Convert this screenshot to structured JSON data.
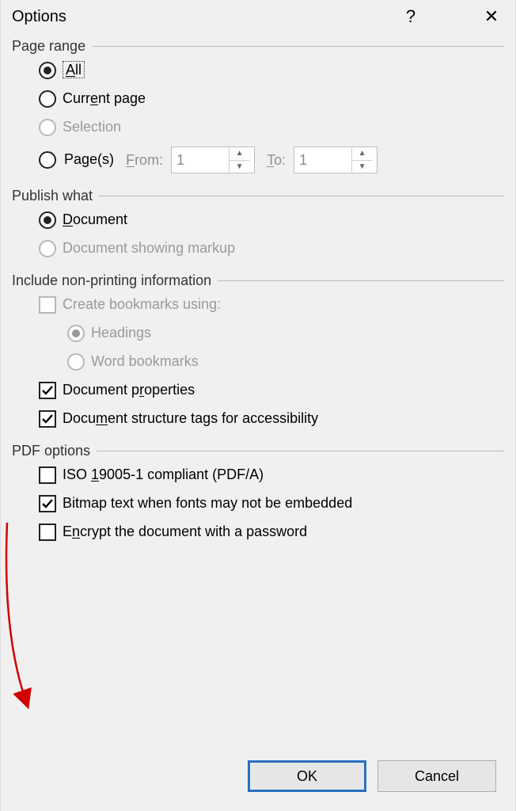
{
  "title": "Options",
  "page_range": {
    "label": "Page range",
    "all": "All",
    "current": "Current page",
    "selection": "Selection",
    "pages": "Page(s)",
    "from_label": "From:",
    "to_label": "To:",
    "from_value": "1",
    "to_value": "1"
  },
  "publish_what": {
    "label": "Publish what",
    "document": "Document",
    "markup": "Document showing markup"
  },
  "include": {
    "label": "Include non-printing information",
    "create_bookmarks": "Create bookmarks using:",
    "headings": "Headings",
    "word_bookmarks": "Word bookmarks",
    "doc_properties": "Document properties",
    "doc_structure": "Document structure tags for accessibility"
  },
  "pdf_options": {
    "label": "PDF options",
    "iso": "ISO 19005-1 compliant (PDF/A)",
    "bitmap": "Bitmap text when fonts may not be embedded",
    "encrypt": "Encrypt the document with a password"
  },
  "buttons": {
    "ok": "OK",
    "cancel": "Cancel"
  }
}
